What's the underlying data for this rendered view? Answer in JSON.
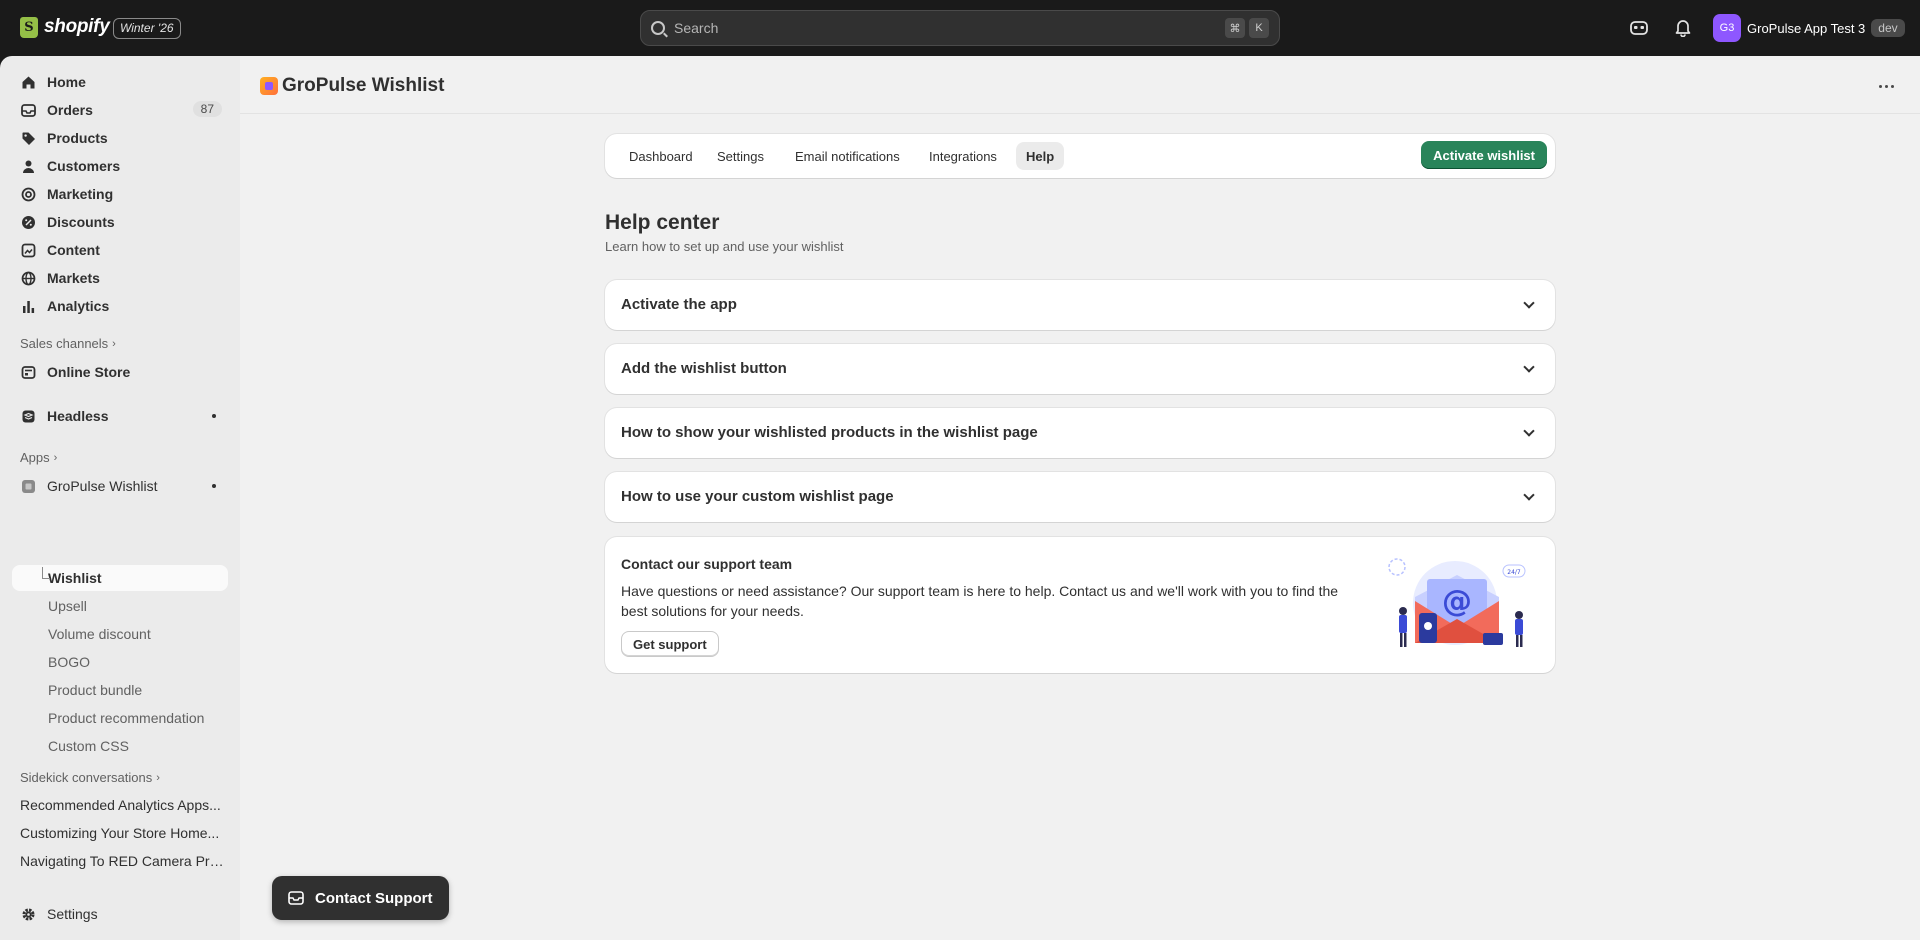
{
  "topbar": {
    "logo_text": "shopify",
    "edition": "Winter '26",
    "search_placeholder": "Search",
    "shortcut_keys": [
      "⌘",
      "K"
    ],
    "user_initials": "G3",
    "user_name": "GroPulse App Test 3",
    "env_badge": "dev"
  },
  "sidebar": {
    "items": [
      {
        "label": "Home",
        "icon": "home-icon"
      },
      {
        "label": "Orders",
        "icon": "orders-icon",
        "count": "87"
      },
      {
        "label": "Products",
        "icon": "tag-icon"
      },
      {
        "label": "Customers",
        "icon": "person-icon"
      },
      {
        "label": "Marketing",
        "icon": "target-icon"
      },
      {
        "label": "Discounts",
        "icon": "discount-icon"
      },
      {
        "label": "Content",
        "icon": "content-icon"
      },
      {
        "label": "Markets",
        "icon": "globe-icon"
      },
      {
        "label": "Analytics",
        "icon": "bar-chart-icon"
      }
    ],
    "sales_channels_label": "Sales channels",
    "online_store": "Online Store",
    "headless": "Headless",
    "apps_label": "Apps",
    "app_name": "GroPulse Wishlist",
    "app_subitems": [
      "Wishlist",
      "Upsell",
      "Volume discount",
      "BOGO",
      "Product bundle",
      "Product recommendation",
      "Custom CSS"
    ],
    "sidekick_label": "Sidekick conversations",
    "conversations": [
      "Recommended Analytics Apps...",
      "Customizing Your Store Home...",
      "Navigating To RED Camera Pro..."
    ],
    "settings": "Settings"
  },
  "page": {
    "title": "GroPulse Wishlist",
    "tabs": [
      "Dashboard",
      "Settings",
      "Email notifications",
      "Integrations",
      "Help"
    ],
    "active_tab": "Help",
    "activate_button": "Activate wishlist",
    "help_title": "Help center",
    "help_subtitle": "Learn how to set up and use your wishlist",
    "accordions": [
      "Activate the app",
      "Add the wishlist button",
      "How to show your wishlisted products in the wishlist page",
      "How to use your custom wishlist page"
    ],
    "support": {
      "title": "Contact our support team",
      "text": "Have questions or need assistance? Our support team is here to help. Contact us and we'll work with you to find the best solutions for your needs.",
      "button": "Get support",
      "illustration_badge": "24/7"
    },
    "contact_fab": "Contact Support"
  },
  "colors": {
    "topbar_bg": "#1a1a1a",
    "primary_green": "#29845a",
    "avatar_purple": "#8e57ff",
    "sidebar_bg": "#ebebeb",
    "main_bg": "#f1f1f1"
  }
}
